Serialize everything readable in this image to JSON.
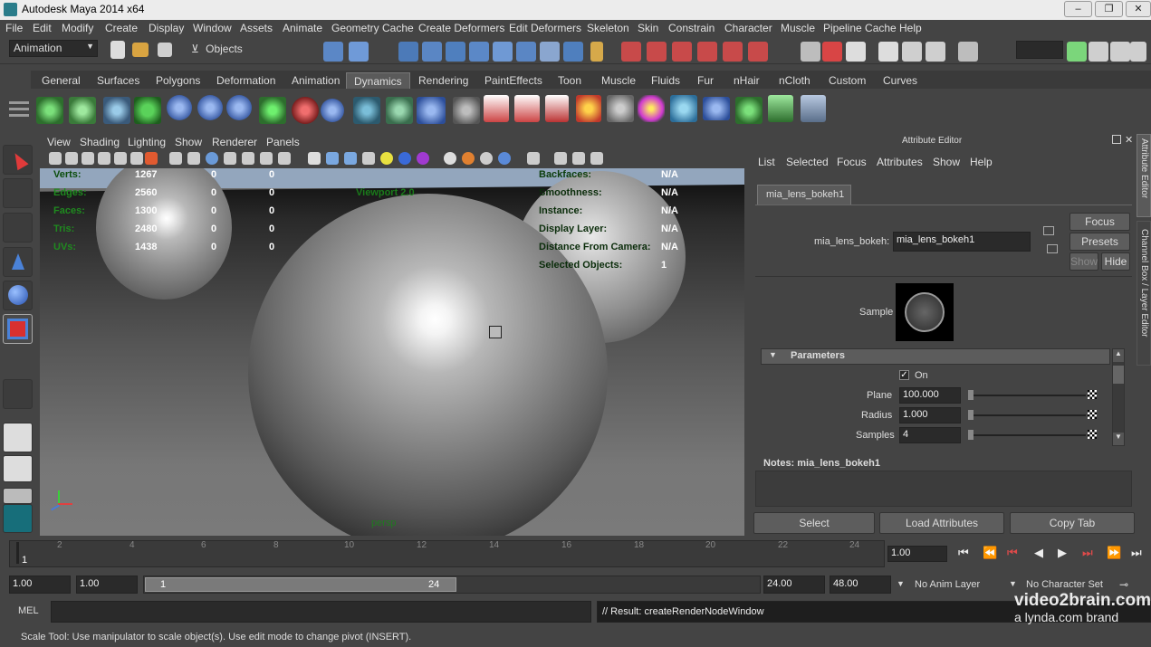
{
  "window": {
    "title": "Autodesk Maya 2014 x64"
  },
  "menu": [
    "File",
    "Edit",
    "Modify",
    "Create",
    "Display",
    "Window",
    "Assets",
    "Animate",
    "Geometry Cache",
    "Create Deformers",
    "Edit Deformers",
    "Skeleton",
    "Skin",
    "Constrain",
    "Character",
    "Muscle",
    "Pipeline Cache",
    "Help"
  ],
  "status": {
    "menuset": "Animation",
    "selmode": "Objects"
  },
  "shelf_tabs": [
    "General",
    "Surfaces",
    "Polygons",
    "Deformation",
    "Animation",
    "Dynamics",
    "Rendering",
    "PaintEffects",
    "Toon",
    "Muscle",
    "Fluids",
    "Fur",
    "nHair",
    "nCloth",
    "Custom",
    "Curves"
  ],
  "shelf_active": "Dynamics",
  "viewport": {
    "menu": [
      "View",
      "Shading",
      "Lighting",
      "Show",
      "Renderer",
      "Panels"
    ],
    "hud_left_labels": [
      "Verts:",
      "Edges:",
      "Faces:",
      "Tris:",
      "UVs:"
    ],
    "hud_left_vals": [
      "1267",
      "2560",
      "1300",
      "2480",
      "1438"
    ],
    "hud_zero": "0",
    "hud_right_labels": [
      "Backfaces:",
      "Smoothness:",
      "Instance:",
      "Display Layer:",
      "Distance From Camera:",
      "Selected Objects:"
    ],
    "hud_right_vals": [
      "N/A",
      "N/A",
      "N/A",
      "N/A",
      "N/A",
      "1"
    ],
    "viewport_label": "Viewport 2.0",
    "camera": "persp"
  },
  "ae": {
    "title": "Attribute Editor",
    "menu": [
      "List",
      "Selected",
      "Focus",
      "Attributes",
      "Show",
      "Help"
    ],
    "node_tab": "mia_lens_bokeh1",
    "node_label": "mia_lens_bokeh:",
    "node_value": "mia_lens_bokeh1",
    "focus": "Focus",
    "presets": "Presets",
    "show": "Show",
    "hide": "Hide",
    "sample": "Sample",
    "section": "Parameters",
    "on_label": "On",
    "params": [
      {
        "label": "Plane",
        "value": "100.000"
      },
      {
        "label": "Radius",
        "value": "1.000"
      },
      {
        "label": "Samples",
        "value": "4"
      }
    ],
    "notes": "Notes:  mia_lens_bokeh1",
    "buttons": [
      "Select",
      "Load Attributes",
      "Copy Tab"
    ],
    "side_tab1": "Attribute Editor",
    "side_tab2": "Channel Box / Layer Editor"
  },
  "timeline": {
    "ticks": [
      "2",
      "4",
      "6",
      "8",
      "10",
      "12",
      "14",
      "16",
      "18",
      "20",
      "22",
      "24"
    ],
    "current": "1",
    "frame_field": "1.00"
  },
  "range": {
    "start": "1.00",
    "start2": "1.00",
    "slider_start": "1",
    "slider_end": "24",
    "end": "24.00",
    "end2": "48.00",
    "anim_layer": "No Anim Layer",
    "char_set": "No Character Set"
  },
  "cmd": {
    "label": "MEL",
    "result": "// Result: createRenderNodeWindow",
    "watermark1": "video2brain.com",
    "watermark2": "a lynda.com brand"
  },
  "help": "Scale Tool: Use manipulator to scale object(s). Use edit mode to change pivot (INSERT)."
}
